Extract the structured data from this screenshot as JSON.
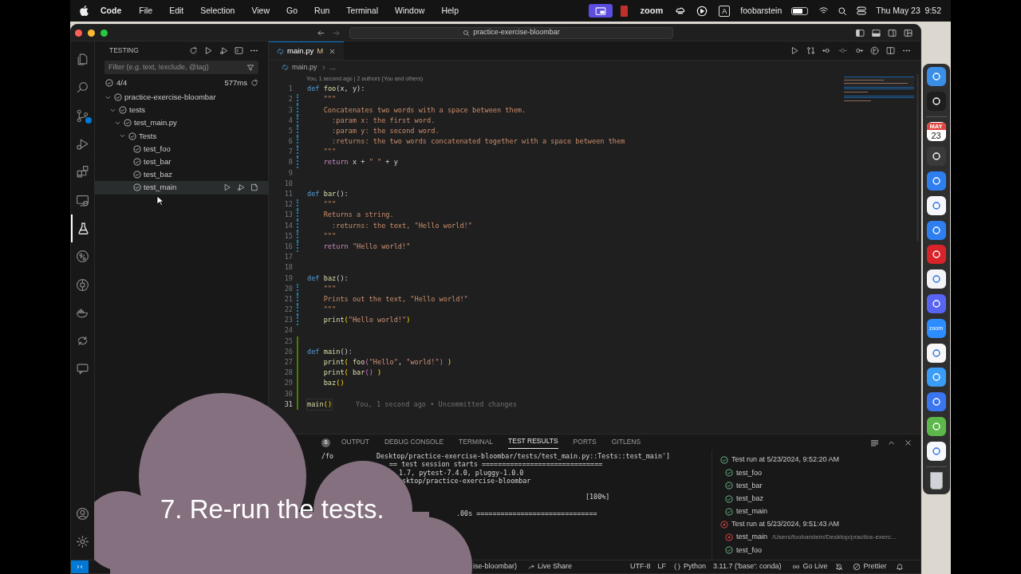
{
  "menubar": {
    "app": "Code",
    "menus": [
      "File",
      "Edit",
      "Selection",
      "View",
      "Go",
      "Run",
      "Terminal",
      "Window",
      "Help"
    ],
    "zoom_label": "zoom",
    "input_source": "A",
    "user": "foobarstein",
    "clock": "Thu May 23  9:52"
  },
  "titlebar": {
    "search": "practice-exercise-bloombar"
  },
  "activity_bar": [
    {
      "kind": "files",
      "selected": false
    },
    {
      "kind": "search",
      "selected": false
    },
    {
      "kind": "scm",
      "selected": false
    },
    {
      "kind": "debug",
      "selected": false
    },
    {
      "kind": "extensions",
      "selected": false
    },
    {
      "kind": "remote",
      "selected": false
    },
    {
      "kind": "testing",
      "selected": true
    },
    {
      "kind": "git",
      "selected": false
    },
    {
      "kind": "gitlens",
      "selected": false
    },
    {
      "kind": "docker",
      "selected": false
    },
    {
      "kind": "share",
      "selected": false
    },
    {
      "kind": "comments",
      "selected": false
    }
  ],
  "sidebar": {
    "title": "TESTING",
    "filter_placeholder": "Filter (e.g. text, !exclude, @tag)",
    "summary": "4/4",
    "duration": "577ms",
    "tree": [
      {
        "label": "practice-exercise-bloombar",
        "expanded": true,
        "hovered": false,
        "children": [
          {
            "label": "tests",
            "expanded": true,
            "hovered": false,
            "children": [
              {
                "label": "test_main.py",
                "expanded": true,
                "hovered": false,
                "children": [
                  {
                    "label": "Tests",
                    "expanded": true,
                    "hovered": false,
                    "children": [
                      {
                        "label": "test_foo",
                        "hovered": false
                      },
                      {
                        "label": "test_bar",
                        "hovered": false
                      },
                      {
                        "label": "test_baz",
                        "hovered": false
                      },
                      {
                        "label": "test_main",
                        "hovered": true
                      }
                    ]
                  }
                ]
              }
            ]
          }
        ]
      }
    ]
  },
  "editor": {
    "tabs": [
      {
        "label": "main.py",
        "status": "M",
        "selected": true
      }
    ],
    "breadcrumb": [
      "main.py",
      "..."
    ],
    "blame": "You, 1 second ago | 2 authors (You and others)",
    "inline_blame": "You, 1 second ago • Uncommitted changes",
    "lines": [
      {
        "number": "1",
        "kind": "unchanged",
        "current": false,
        "tokens": [
          {
            "text": "def",
            "kind": "keyword"
          },
          {
            "text": " foo",
            "kind": "function"
          },
          {
            "text": "(x, y):",
            "kind": "plain"
          }
        ]
      },
      {
        "number": "2",
        "kind": "modified",
        "current": false,
        "tokens": [
          {
            "text": "    \"\"\"",
            "kind": "docstring"
          }
        ]
      },
      {
        "number": "3",
        "kind": "modified",
        "current": false,
        "tokens": [
          {
            "text": "    Concatenates two words with a space between them.",
            "kind": "docstring"
          }
        ]
      },
      {
        "number": "4",
        "kind": "modified",
        "current": false,
        "tokens": [
          {
            "text": "      :param x: the first word.",
            "kind": "docstring"
          }
        ]
      },
      {
        "number": "5",
        "kind": "modified",
        "current": false,
        "tokens": [
          {
            "text": "      :param y: the second word.",
            "kind": "docstring"
          }
        ]
      },
      {
        "number": "6",
        "kind": "modified",
        "current": false,
        "tokens": [
          {
            "text": "      :returns: the two words concatenated together with a space between them",
            "kind": "docstring"
          }
        ]
      },
      {
        "number": "7",
        "kind": "modified",
        "current": false,
        "tokens": [
          {
            "text": "    \"\"\"",
            "kind": "docstring"
          }
        ]
      },
      {
        "number": "8",
        "kind": "modified",
        "current": false,
        "tokens": [
          {
            "text": "    return",
            "kind": "control"
          },
          {
            "text": " x + ",
            "kind": "plain"
          },
          {
            "text": "\" \"",
            "kind": "string"
          },
          {
            "text": " + y",
            "kind": "plain"
          }
        ]
      },
      {
        "number": "9",
        "kind": "unchanged",
        "current": false
      },
      {
        "number": "10",
        "kind": "unchanged",
        "current": false
      },
      {
        "number": "11",
        "kind": "unchanged",
        "current": false,
        "tokens": [
          {
            "text": "def",
            "kind": "keyword"
          },
          {
            "text": " bar",
            "kind": "function"
          },
          {
            "text": "():",
            "kind": "plain"
          }
        ]
      },
      {
        "number": "12",
        "kind": "modified",
        "current": false,
        "tokens": [
          {
            "text": "    \"\"\"",
            "kind": "docstring"
          }
        ]
      },
      {
        "number": "13",
        "kind": "modified",
        "current": false,
        "tokens": [
          {
            "text": "    Returns a string.",
            "kind": "docstring"
          }
        ]
      },
      {
        "number": "14",
        "kind": "modified",
        "current": false,
        "tokens": [
          {
            "text": "      :returns: the text, \"Hello world!\"",
            "kind": "docstring"
          }
        ]
      },
      {
        "number": "15",
        "kind": "modified",
        "current": false,
        "tokens": [
          {
            "text": "    \"\"\"",
            "kind": "docstring"
          }
        ]
      },
      {
        "number": "16",
        "kind": "modified",
        "current": false,
        "tokens": [
          {
            "text": "    return",
            "kind": "control"
          },
          {
            "text": " \"Hello world!\"",
            "kind": "string"
          }
        ]
      },
      {
        "number": "17",
        "kind": "unchanged",
        "current": false
      },
      {
        "number": "18",
        "kind": "unchanged",
        "current": false
      },
      {
        "number": "19",
        "kind": "unchanged",
        "current": false,
        "tokens": [
          {
            "text": "def",
            "kind": "keyword"
          },
          {
            "text": " baz",
            "kind": "function"
          },
          {
            "text": "():",
            "kind": "plain"
          }
        ]
      },
      {
        "number": "20",
        "kind": "modified",
        "current": false,
        "tokens": [
          {
            "text": "    \"\"\"",
            "kind": "docstring"
          }
        ]
      },
      {
        "number": "21",
        "kind": "modified",
        "current": false,
        "tokens": [
          {
            "text": "    Prints out the text, \"Hello world!\"",
            "kind": "docstring"
          }
        ]
      },
      {
        "number": "22",
        "kind": "modified",
        "current": false,
        "tokens": [
          {
            "text": "    \"\"\"",
            "kind": "docstring"
          }
        ]
      },
      {
        "number": "23",
        "kind": "modified",
        "current": false,
        "tokens": [
          {
            "text": "    print",
            "kind": "function"
          },
          {
            "text": "(",
            "kind": "bracket"
          },
          {
            "text": "\"Hello world!\"",
            "kind": "string"
          },
          {
            "text": ")",
            "kind": "bracket"
          }
        ]
      },
      {
        "number": "24",
        "kind": "unchanged",
        "current": false
      },
      {
        "number": "25",
        "kind": "added",
        "current": false
      },
      {
        "number": "26",
        "kind": "added",
        "current": false,
        "tokens": [
          {
            "text": "def",
            "kind": "keyword"
          },
          {
            "text": " main",
            "kind": "function"
          },
          {
            "text": "():",
            "kind": "plain"
          }
        ]
      },
      {
        "number": "27",
        "kind": "added",
        "current": false,
        "tokens": [
          {
            "text": "    print",
            "kind": "function"
          },
          {
            "text": "( ",
            "kind": "bracket"
          },
          {
            "text": "foo",
            "kind": "function"
          },
          {
            "text": "(",
            "kind": "bracket2"
          },
          {
            "text": "\"Hello\"",
            "kind": "string"
          },
          {
            "text": ", ",
            "kind": "plain"
          },
          {
            "text": "\"world!\"",
            "kind": "string"
          },
          {
            "text": ")",
            "kind": "bracket2"
          },
          {
            "text": " )",
            "kind": "bracket"
          }
        ]
      },
      {
        "number": "28",
        "kind": "added",
        "current": false,
        "tokens": [
          {
            "text": "    print",
            "kind": "function"
          },
          {
            "text": "( ",
            "kind": "bracket"
          },
          {
            "text": "bar",
            "kind": "function"
          },
          {
            "text": "()",
            "kind": "bracket2"
          },
          {
            "text": " )",
            "kind": "bracket"
          }
        ]
      },
      {
        "number": "29",
        "kind": "added",
        "current": false,
        "tokens": [
          {
            "text": "    baz",
            "kind": "function"
          },
          {
            "text": "()",
            "kind": "bracket"
          }
        ]
      },
      {
        "number": "30",
        "kind": "added",
        "current": false
      },
      {
        "number": "31",
        "kind": "added",
        "current": true,
        "tokens": [
          {
            "text": "main",
            "kind": "function"
          },
          {
            "text": "()",
            "kind": "bracket"
          }
        ]
      }
    ]
  },
  "panel": {
    "badge": "6",
    "tabs": [
      {
        "label": "OUTPUT",
        "selected": false
      },
      {
        "label": "DEBUG CONSOLE",
        "selected": false
      },
      {
        "label": "TERMINAL",
        "selected": false
      },
      {
        "label": "TEST RESULTS",
        "selected": true
      },
      {
        "label": "PORTS",
        "selected": false
      },
      {
        "label": "GITLENS",
        "selected": false
      }
    ],
    "terminal_lines": [
      "/fo",
      "Desktop/practice-exercise-bloombar/tests/test_main.py::Tests::test_main']",
      "== test session starts ==============================",
      "1.7, pytest-7.4.0, pluggy-1.0.0",
      "sktop/practice-exercise-bloombar",
      "[100%]",
      ".00s =============================="
    ],
    "results": [
      {
        "label": "Test run at 5/23/2024, 9:52:20 AM",
        "passed": true,
        "children": [
          {
            "label": "test_foo",
            "passed": true
          },
          {
            "label": "test_bar",
            "passed": true
          },
          {
            "label": "test_baz",
            "passed": true
          },
          {
            "label": "test_main",
            "passed": true
          }
        ]
      },
      {
        "label": "Test run at 5/23/2024, 9:51:43 AM",
        "passed": false,
        "children": [
          {
            "label": "test_main",
            "passed": false,
            "detail": "/Users/foobarstein/Desktop/practice-exerc..."
          },
          {
            "label": "test_foo",
            "passed": true
          }
        ]
      }
    ]
  },
  "status_bar": {
    "left": "ise-bloombar)",
    "items": [
      {
        "kind": "liveshare",
        "label": "Live Share"
      },
      {
        "kind": "text",
        "label": "UTF-8"
      },
      {
        "kind": "text",
        "label": "LF"
      },
      {
        "kind": "braces",
        "label": "Python"
      },
      {
        "kind": "text",
        "label": "3.11.7 ('base': conda)"
      },
      {
        "kind": "golive",
        "label": "Go Live"
      },
      {
        "kind": "prettier",
        "label": "Prettier"
      }
    ]
  },
  "dock": [
    {
      "kind": "finder",
      "color": "#3a8ee6"
    },
    {
      "kind": "figma",
      "color": "#1e1e1e"
    },
    {
      "kind": "calendar",
      "color": "#ffffff",
      "month": "MAY",
      "day": "23"
    },
    {
      "kind": "sublime",
      "color": "#3a3a3a"
    },
    {
      "kind": "xcode",
      "color": "#2f7ef0"
    },
    {
      "kind": "instruments",
      "color": "#f4f6fb"
    },
    {
      "kind": "xcode",
      "color": "#2f7ef0"
    },
    {
      "kind": "vpn",
      "color": "#d8232a"
    },
    {
      "kind": "cube",
      "color": "#f2f4f8"
    },
    {
      "kind": "chat",
      "color": "#5865f2"
    },
    {
      "kind": "zoom",
      "color": "#2d8cff",
      "label": "zoom"
    },
    {
      "kind": "lion",
      "color": "#f7f7f7"
    },
    {
      "kind": "mail",
      "color": "#3b9cf5"
    },
    {
      "kind": "bubble",
      "color": "#3a76f0"
    },
    {
      "kind": "camtasia",
      "color": "#5cb84a"
    },
    {
      "kind": "vscode",
      "color": "#f5f7fa"
    }
  ],
  "caption": "7. Re-run the tests."
}
